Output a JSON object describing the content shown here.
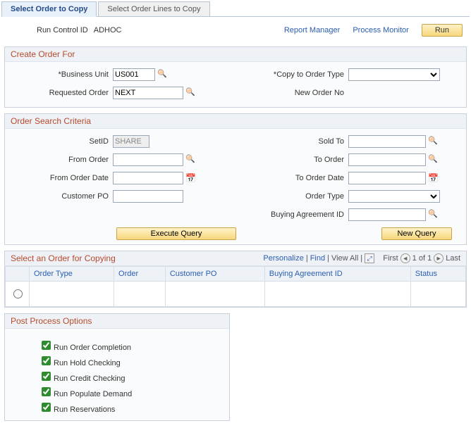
{
  "tabs": {
    "t1": "Select Order to Copy",
    "t2": "Select Order Lines to Copy"
  },
  "top": {
    "runcontrol_label": "Run Control ID",
    "runcontrol_value": "ADHOC",
    "report_manager": "Report Manager",
    "process_monitor": "Process Monitor",
    "run": "Run"
  },
  "create": {
    "title": "Create Order For",
    "business_unit_label": "*Business Unit",
    "business_unit_value": "US001",
    "copy_to_label": "*Copy to Order Type",
    "copy_to_value": "",
    "requested_order_label": "Requested Order",
    "requested_order_value": "NEXT",
    "new_order_no_label": "New Order No",
    "new_order_no_value": ""
  },
  "search": {
    "title": "Order Search Criteria",
    "setid_label": "SetID",
    "setid_value": "SHARE",
    "sold_to_label": "Sold To",
    "sold_to_value": "",
    "from_order_label": "From Order",
    "from_order_value": "",
    "to_order_label": "To Order",
    "to_order_value": "",
    "from_date_label": "From Order Date",
    "from_date_value": "",
    "to_date_label": "To Order Date",
    "to_date_value": "",
    "customer_po_label": "Customer PO",
    "customer_po_value": "",
    "order_type_label": "Order Type",
    "order_type_value": "",
    "buying_agreement_label": "Buying Agreement ID",
    "buying_agreement_value": "",
    "execute_query": "Execute Query",
    "new_query": "New Query"
  },
  "grid": {
    "title": "Select an Order for Copying",
    "personalize": "Personalize",
    "find": "Find",
    "view_all": "View All",
    "first": "First",
    "page_info": "1 of 1",
    "last": "Last",
    "columns": {
      "order_type": "Order Type",
      "order": "Order",
      "customer_po": "Customer PO",
      "buying_agreement": "Buying Agreement ID",
      "status": "Status"
    },
    "rows": {
      "r1": {
        "order_type": "",
        "order": "",
        "customer_po": "",
        "buying_agreement": "",
        "status": ""
      }
    }
  },
  "post": {
    "title": "Post Process Options",
    "opt1": "Run Order Completion",
    "opt2": "Run Hold Checking",
    "opt3": "Run Credit Checking",
    "opt4": "Run Populate Demand",
    "opt5": "Run Reservations"
  }
}
